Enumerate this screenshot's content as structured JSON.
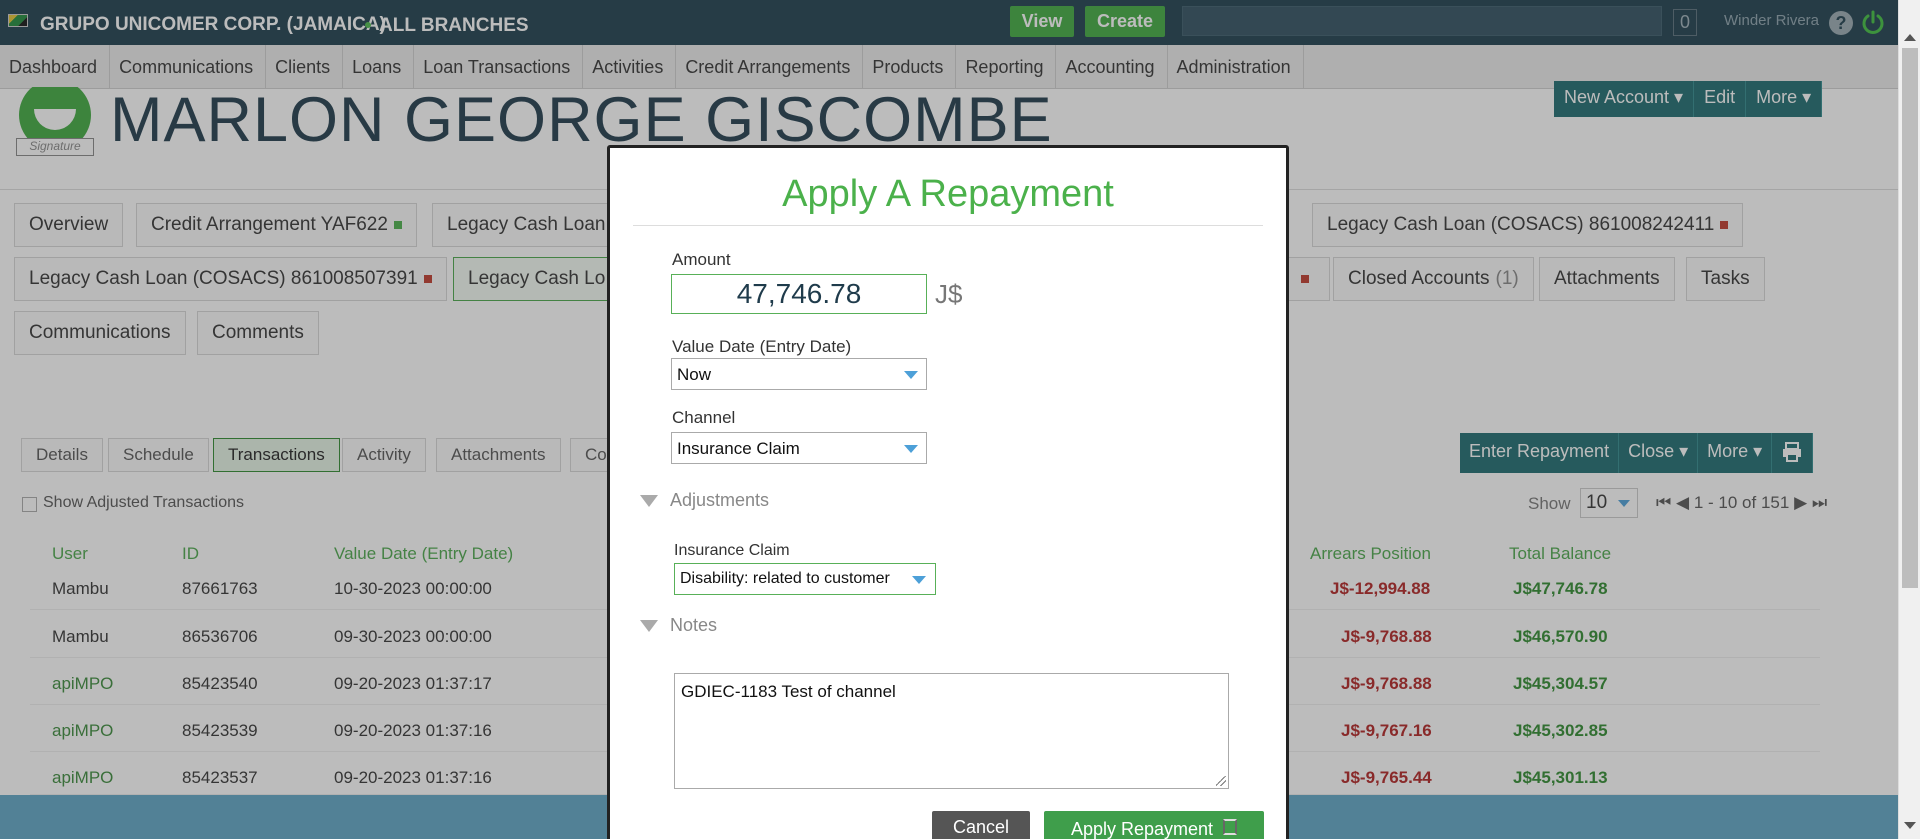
{
  "topbar": {
    "org_name": "GRUPO UNICOMER CORP. (JAMAICA)",
    "branch": "ALL BRANCHES",
    "view_label": "View",
    "create_label": "Create",
    "search_placeholder": "",
    "notification_count": "0",
    "user_name": "Winder Rivera",
    "help_glyph": "?"
  },
  "nav": {
    "items": [
      {
        "label": "Dashboard"
      },
      {
        "label": "Communications"
      },
      {
        "label": "Clients"
      },
      {
        "label": "Loans"
      },
      {
        "label": "Loan Transactions"
      },
      {
        "label": "Activities"
      },
      {
        "label": "Credit Arrangements"
      },
      {
        "label": "Products"
      },
      {
        "label": "Reporting"
      },
      {
        "label": "Accounting"
      },
      {
        "label": "Administration"
      }
    ]
  },
  "client": {
    "name": "MARLON GEORGE GISCOMBE",
    "avatar_label": "Signature",
    "actions": [
      "New Account ▾",
      "Edit",
      "More ▾"
    ]
  },
  "tabs": {
    "overview": "Overview",
    "credit_arrangement": "Credit Arrangement YAF622",
    "legacy_1": "Legacy Cash Loan",
    "legacy_right": "Legacy Cash Loan (COSACS) 861008242411",
    "legacy_2": "Legacy Cash Loan (COSACS) 861008507391",
    "legacy_active": "Legacy Cash Lo",
    "closed_accounts": "Closed Accounts",
    "closed_count": "(1)",
    "attachments": "Attachments",
    "tasks": "Tasks",
    "communications": "Communications",
    "comments": "Comments"
  },
  "subtabs": {
    "details": "Details",
    "schedule": "Schedule",
    "transactions": "Transactions",
    "activity": "Activity",
    "attachments": "Attachments",
    "partial": "Co"
  },
  "tx_actions": {
    "enter_repayment": "Enter Repayment",
    "close": "Close ▾",
    "more": "More ▾"
  },
  "transactions": {
    "show_adjusted_label": "Show Adjusted Transactions",
    "pager_show_label": "Show",
    "page_size": "10",
    "page_range": "1 - 10 of 151",
    "columns": {
      "user": "User",
      "id": "ID",
      "value_date": "Value Date (Entry Date)",
      "arrears": "Arrears Position",
      "total_balance": "Total Balance"
    },
    "rows": [
      {
        "user": "Mambu",
        "id": "87661763",
        "date": "10-30-2023 00:00:00",
        "arrears": "J$-12,994.88",
        "balance": "J$47,746.78"
      },
      {
        "user": "Mambu",
        "id": "86536706",
        "date": "09-30-2023 00:00:00",
        "arrears": "J$-9,768.88",
        "balance": "J$46,570.90"
      },
      {
        "user": "apiMPO",
        "id": "85423540",
        "date": "09-20-2023 01:37:17",
        "arrears": "J$-9,768.88",
        "balance": "J$45,304.57"
      },
      {
        "user": "apiMPO",
        "id": "85423539",
        "date": "09-20-2023 01:37:16",
        "arrears": "J$-9,767.16",
        "balance": "J$45,302.85"
      },
      {
        "user": "apiMPO",
        "id": "85423537",
        "date": "09-20-2023 01:37:16",
        "arrears": "J$-9,765.44",
        "balance": "J$45,301.13"
      }
    ]
  },
  "modal": {
    "title": "Apply A Repayment",
    "amount_label": "Amount",
    "amount_value": "47,746.78",
    "currency": "J$",
    "value_date_label": "Value Date (Entry Date)",
    "value_date_value": "Now",
    "channel_label": "Channel",
    "channel_value": "Insurance Claim",
    "adjustments_label": "Adjustments",
    "insurance_claim_label": "Insurance Claim",
    "insurance_claim_value": "Disability: related to customer",
    "notes_label": "Notes",
    "notes_value": "GDIEC-1183 Test of channel",
    "cancel_label": "Cancel",
    "apply_label": "Apply Repayment"
  },
  "colors": {
    "topbar": "#1c3e4d",
    "accent_green": "#4bb14b",
    "action_teal": "#1c6b6f",
    "negative": "#b22222",
    "positive": "#2e8b2e",
    "status_red": "#c0392b",
    "status_green": "#4bb14b"
  },
  "icons": {
    "flag": "flag-icon",
    "help": "help-icon",
    "power": "power-icon",
    "caret": "chevron-down-icon",
    "collapse": "triangle-down-icon",
    "printer": "printer-icon"
  }
}
